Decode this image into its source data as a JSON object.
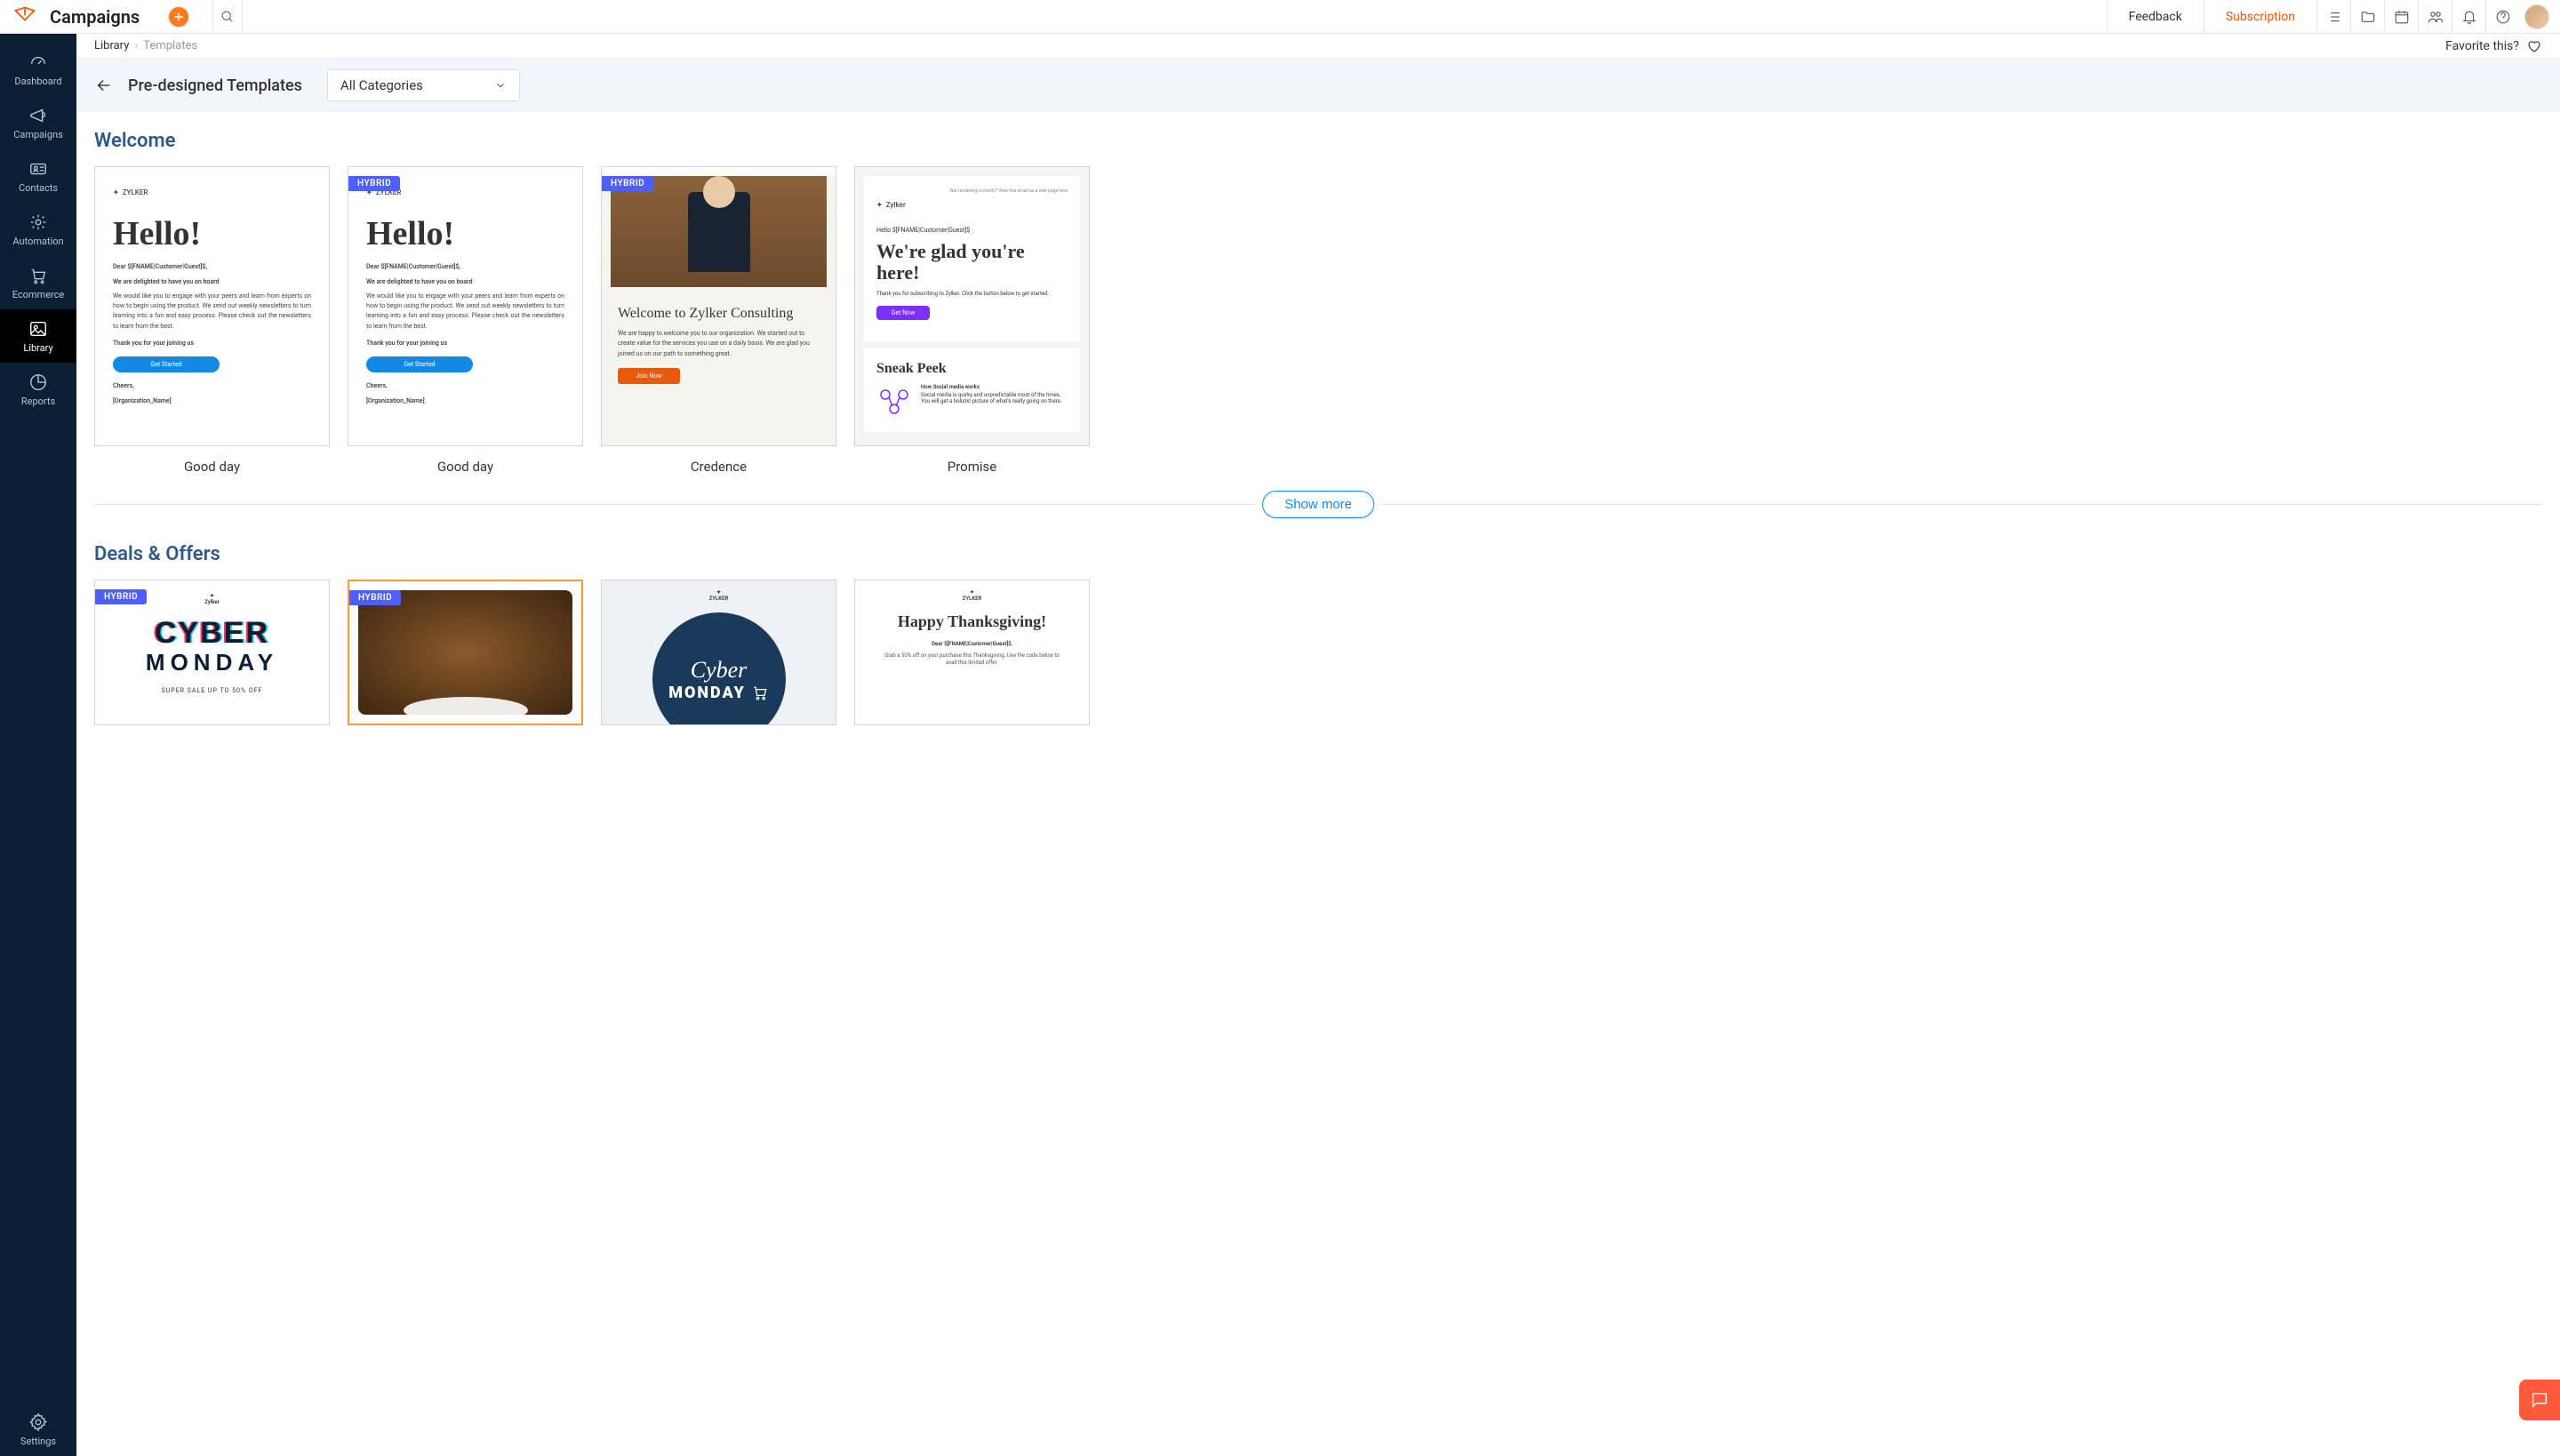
{
  "app": {
    "title": "Campaigns"
  },
  "topbar": {
    "feedback": "Feedback",
    "subscription": "Subscription"
  },
  "sidebar": {
    "items": [
      {
        "label": "Dashboard"
      },
      {
        "label": "Campaigns"
      },
      {
        "label": "Contacts"
      },
      {
        "label": "Automation"
      },
      {
        "label": "Ecommerce"
      },
      {
        "label": "Library"
      },
      {
        "label": "Reports"
      }
    ],
    "settings": "Settings"
  },
  "breadcrumb": {
    "root": "Library",
    "current": "Templates",
    "favorite": "Favorite this?"
  },
  "header": {
    "title": "Pre-designed Templates",
    "category": "All Categories"
  },
  "badges": {
    "hybrid": "HYBRID"
  },
  "actions": {
    "showMore": "Show more"
  },
  "sections": [
    {
      "title": "Welcome",
      "templates": [
        {
          "name": "Good day",
          "hybrid": false
        },
        {
          "name": "Good day",
          "hybrid": true
        },
        {
          "name": "Credence",
          "hybrid": true
        },
        {
          "name": "Promise",
          "hybrid": false
        }
      ]
    },
    {
      "title": "Deals & Offers",
      "templates": [
        {
          "name": "",
          "hybrid": true
        },
        {
          "name": "",
          "hybrid": true,
          "selected": true
        },
        {
          "name": "",
          "hybrid": false
        },
        {
          "name": "",
          "hybrid": false
        }
      ]
    }
  ],
  "previews": {
    "hello": {
      "brand": "ZYLKER",
      "heading": "Hello!",
      "dear": "Dear $[FNAME|Customer|Guest]$,",
      "line1": "We are delighted to have you on board",
      "body": "We would like you to engage with your peers and learn from experts on how to begin using the product. We send out weekly newsletters to turn learning into a fun and easy process. Please check out the newsletters to learn from the best.",
      "thanks": "Thank you for your joining us",
      "cta": "Get Started",
      "cheers": "Cheers,",
      "org": "[Organization_Name]"
    },
    "credence": {
      "heading": "Welcome to Zylker Consulting",
      "body": "We are happy to welcome you to our organization. We started out to create value for the services you use on a daily basis. We are glad you joined us on our path to something great.",
      "cta": "Join Now"
    },
    "promise": {
      "topNote": "Not rendering correctly? View this email as a web page here",
      "brand": "Zylker",
      "greeting": "Hello $[FNAME|Customer|Guest]$",
      "heading": "We're glad you're here!",
      "body": "Thank you for subscribing to Zylker. Click the button below to get started.",
      "cta": "Get Now",
      "sneak": "Sneak Peek",
      "sneakTitle": "How Social media works",
      "sneakBody": "Social media is quirky and unpredictable most of the times. You will get a holistic picture of what's really going on there."
    },
    "cyber": {
      "brand": "Zylker",
      "line1": "CYBER",
      "line2": "MONDAY",
      "sub": "SUPER SALE UP TO 50% OFF"
    },
    "cyber2": {
      "brand": "ZYLKER",
      "cursive": "Cyber",
      "bold": "MONDAY"
    },
    "happy": {
      "brand": "ZYLKER",
      "heading": "Happy Thanksgiving!",
      "dear": "Dear $[FNAME|Customer|Guest]$,",
      "body": "Grab a 50% off on your purchase this Thanksgiving. Use the code below to avail this limited offer."
    }
  }
}
